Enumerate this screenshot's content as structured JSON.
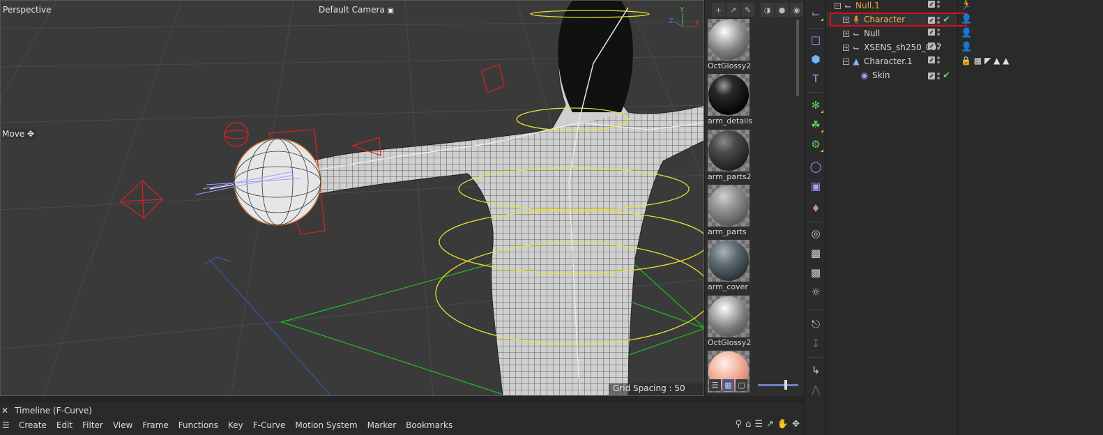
{
  "viewport": {
    "view_name": "Perspective",
    "camera": "Default Camera",
    "camera_icon": "camera-icon",
    "tool_label": "Move",
    "grid_spacing": "Grid Spacing : 50 cm",
    "axis_labels": {
      "x": "X",
      "y": "Y",
      "z": "Z"
    }
  },
  "materials": {
    "items": [
      {
        "name": "OctGlossy2",
        "style": "glossy"
      },
      {
        "name": "arm_details",
        "style": "black"
      },
      {
        "name": "arm_parts2",
        "style": "darkgrey"
      },
      {
        "name": "arm_parts",
        "style": "grey"
      },
      {
        "name": "arm_cover",
        "style": "slate"
      },
      {
        "name": "OctGlossy2",
        "style": "glossy"
      },
      {
        "name": "",
        "style": "pink"
      }
    ]
  },
  "objects": {
    "rows": [
      {
        "name": "Null.1",
        "icon": "null-icon",
        "color": "#e8a23a",
        "indent": 0,
        "expander": "-",
        "check": false,
        "tag": "run-figure-icon"
      },
      {
        "name": "Character",
        "icon": "character-icon",
        "color": "#f0c24a",
        "indent": 1,
        "expander": "+",
        "check": true,
        "tag": "person-icon"
      },
      {
        "name": "Null",
        "icon": "null-icon",
        "color": "#d8d8d8",
        "indent": 1,
        "expander": "+",
        "check": false,
        "tag": "person-icon"
      },
      {
        "name": "XSENS_sh250_007",
        "icon": "null-icon",
        "color": "#d8d8d8",
        "indent": 1,
        "expander": "+",
        "check": false,
        "tag": "person-icon"
      },
      {
        "name": "Character.1",
        "icon": "character-cone-icon",
        "color": "#d8d8d8",
        "indent": 1,
        "expander": "-",
        "check": false,
        "tag": "tags-row"
      },
      {
        "name": "Skin",
        "icon": "skin-icon",
        "color": "#d8d8d8",
        "indent": 2,
        "expander": "",
        "check": true,
        "tag": ""
      }
    ]
  },
  "timeline": {
    "title": "Timeline (F-Curve)",
    "menu": [
      "Create",
      "Edit",
      "Filter",
      "View",
      "Frame",
      "Functions",
      "Key",
      "F-Curve",
      "Motion System",
      "Marker",
      "Bookmarks"
    ]
  }
}
